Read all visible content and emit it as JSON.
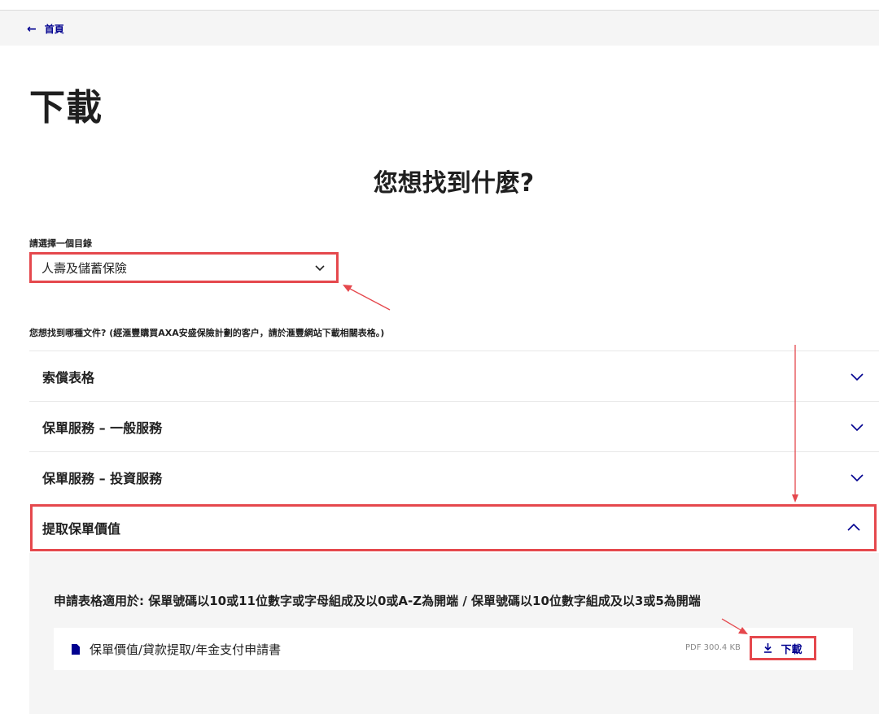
{
  "nav": {
    "back_label": "首頁"
  },
  "page": {
    "title": "下載",
    "question": "您想找到什麼?"
  },
  "category": {
    "label": "請選擇一個目錄",
    "selected": "人壽及儲蓄保險"
  },
  "documents": {
    "question": "您想找到哪種文件? (經滙豐購買AXA安盛保險計劃的客户，請於滙豐網站下載相關表格。)",
    "sections": [
      {
        "label": "索償表格",
        "expanded": false
      },
      {
        "label": "保單服務 – 一般服務",
        "expanded": false
      },
      {
        "label": "保單服務 – 投資服務",
        "expanded": false
      },
      {
        "label": "提取保單價值",
        "expanded": true
      }
    ],
    "panel": {
      "note": "申請表格適用於: 保單號碼以10或11位數字或字母組成及以0或A-Z為開端 / 保單號碼以10位數字組成及以3或5為開端",
      "files": [
        {
          "name": "保單價值/貸款提取/年金支付申請書",
          "meta": "PDF 300.4 KB",
          "download_label": "下載"
        }
      ]
    }
  },
  "colors": {
    "brand_blue": "#00008f",
    "highlight_red": "#e5484d"
  },
  "icons": [
    "arrow-left-icon",
    "chevron-down-icon",
    "chevron-up-icon",
    "file-icon",
    "download-icon"
  ]
}
